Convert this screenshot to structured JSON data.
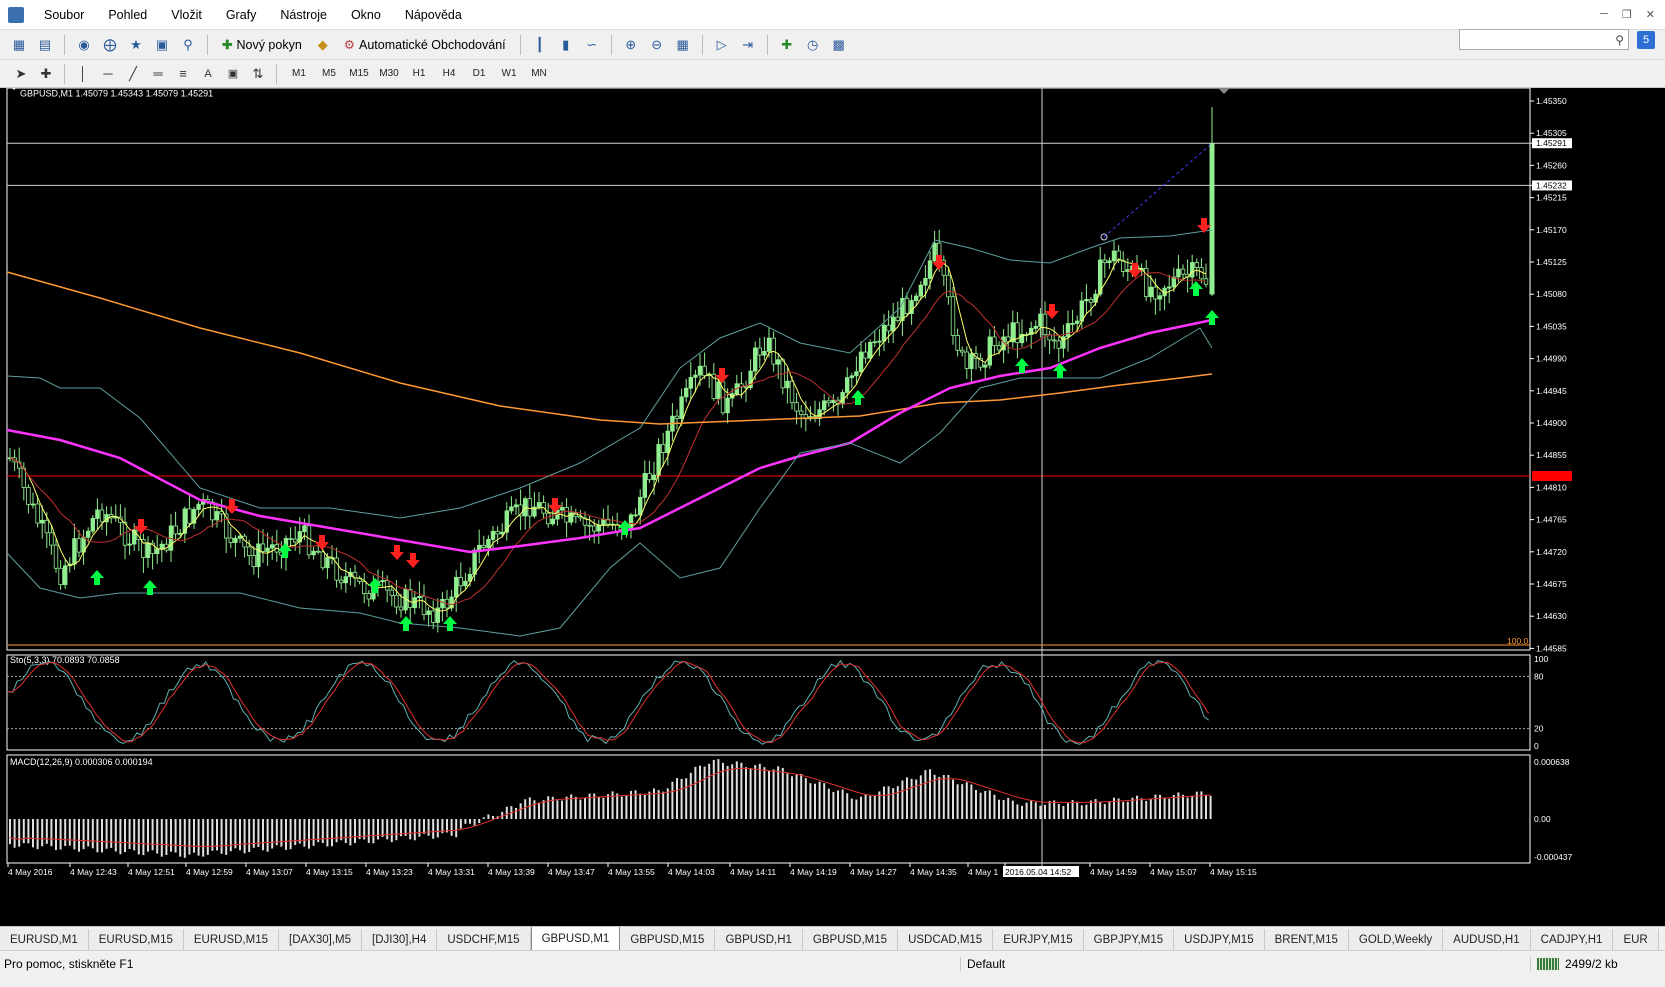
{
  "menu": {
    "items": [
      "Soubor",
      "Pohled",
      "Vložit",
      "Grafy",
      "Nástroje",
      "Okno",
      "Nápověda"
    ]
  },
  "toolbar": {
    "new_order_label": "Nový pokyn",
    "auto_trading_label": "Automatické Obchodování",
    "timeframes": [
      "M1",
      "M5",
      "M15",
      "M30",
      "H1",
      "H4",
      "D1",
      "W1",
      "MN"
    ],
    "search_placeholder": ""
  },
  "chart": {
    "header": "GBPUSD,M1  1.45079 1.45343 1.45079 1.45291",
    "price_labels": [
      "1.45350",
      "1.45305",
      "1.45291",
      "1.45260",
      "1.45232",
      "1.45215",
      "1.45170",
      "1.45125",
      "1.45080",
      "1.45035",
      "1.44990",
      "1.44945",
      "1.44900",
      "1.44855",
      "1.44810",
      "1.44765",
      "1.44720",
      "1.44675",
      "1.44630",
      "1.44585"
    ],
    "level_tag": "100.0",
    "sto_header": "Sto(5,3,3) 70.0893 70.0858",
    "sto_levels": [
      "100",
      "80",
      "20",
      "0"
    ],
    "macd_header": "MACD(12,26,9) 0.000306 0.000194",
    "macd_levels": [
      "0.000638",
      "0.00",
      "-0.000437"
    ],
    "time_labels": [
      "4 May 2016",
      "4 May 12:43",
      "4 May 12:51",
      "4 May 12:59",
      "4 May 13:07",
      "4 May 13:15",
      "4 May 13:23",
      "4 May 13:31",
      "4 May 13:39",
      "4 May 13:47",
      "4 May 13:55",
      "4 May 14:03",
      "4 May 14:11",
      "4 May 14:19",
      "4 May 14:27",
      "4 May 14:35",
      "4 May 1",
      "2016.05.04 14:52",
      "4 May 14:59",
      "4 May 15:07",
      "4 May 15:15"
    ],
    "colors": {
      "bull": "#90ee90",
      "bear": "#000000",
      "wick": "#90ee90",
      "ema_slow": "#ff9933",
      "ema_mid": "#ff33ff",
      "ema_fast": "#ffff66",
      "bands": "#5f9ea0",
      "red_line": "#ff0000",
      "up_arrow": "#00ff44",
      "down_arrow": "#ff2020",
      "grid": "#808080"
    }
  },
  "tabs": {
    "items": [
      "EURUSD,M1",
      "EURUSD,M15",
      "EURUSD,M15",
      "[DAX30],M5",
      "[DJI30],H4",
      "USDCHF,M15",
      "GBPUSD,M1",
      "GBPUSD,M15",
      "GBPUSD,H1",
      "GBPUSD,M15",
      "USDCAD,M15",
      "EURJPY,M15",
      "GBPJPY,M15",
      "USDJPY,M15",
      "BRENT,M15",
      "GOLD,Weekly",
      "AUDUSD,H1",
      "CADJPY,H1",
      "EUR"
    ],
    "active_index": 6
  },
  "status": {
    "help_text": "Pro pomoc, stiskněte F1",
    "profile": "Default",
    "traffic": "2499/2 kb"
  }
}
